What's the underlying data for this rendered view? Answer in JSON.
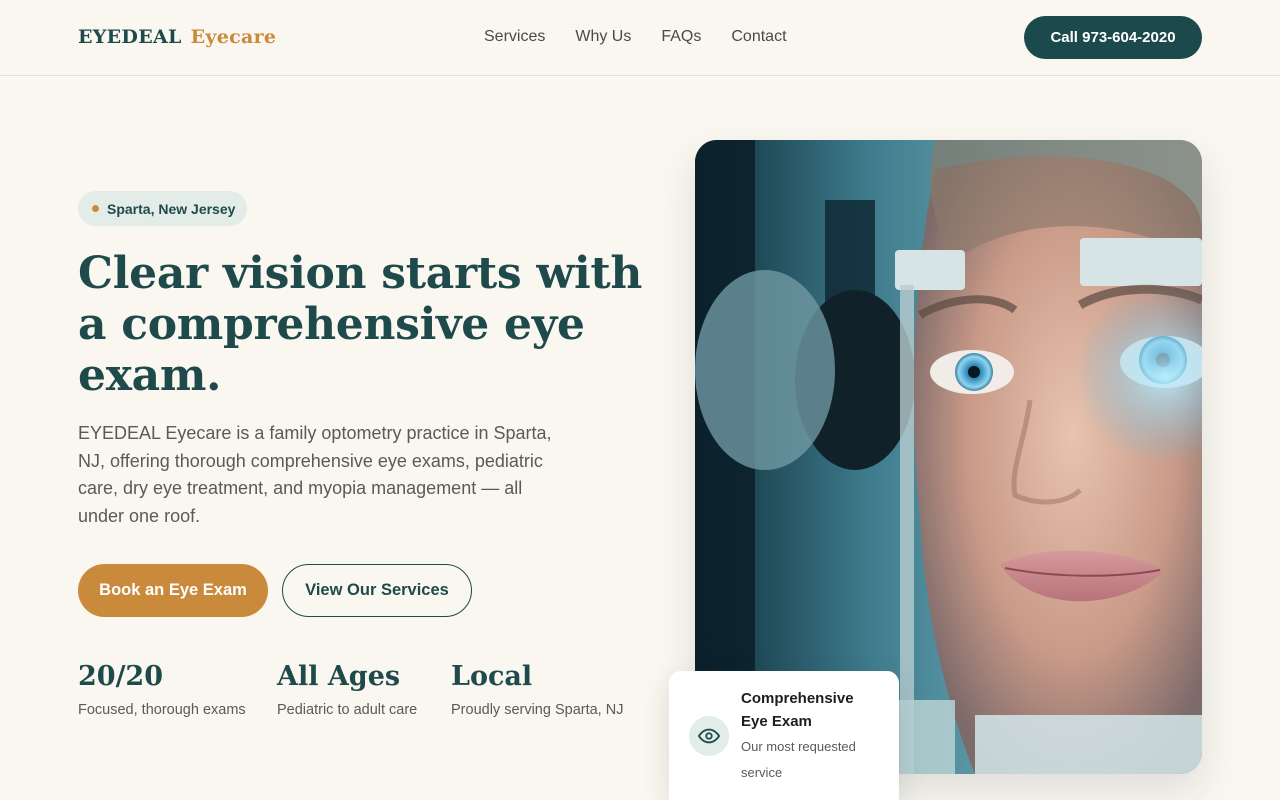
{
  "header": {
    "logo_main": "EYEDEAL",
    "logo_accent": "Eyecare",
    "nav": [
      "Services",
      "Why Us",
      "FAQs",
      "Contact"
    ],
    "call_label": "Call 973-604-2020"
  },
  "hero": {
    "location_badge": "Sparta, New Jersey",
    "headline": "Clear vision starts with a comprehensive eye exam.",
    "description": "EYEDEAL Eyecare is a family optometry practice in Sparta, NJ, offering thorough comprehensive eye exams, pediatric care, dry eye treatment, and myopia management — all under one roof.",
    "primary_cta": "Book an Eye Exam",
    "secondary_cta": "View Our Services",
    "stats": [
      {
        "value": "20/20",
        "label": "Focused, thorough exams"
      },
      {
        "value": "All Ages",
        "label": "Pediatric to adult care"
      },
      {
        "value": "Local",
        "label": "Proudly serving Sparta, NJ"
      }
    ]
  },
  "feature_card": {
    "title": "Comprehensive Eye Exam",
    "subtitle": "Our most requested service",
    "icon": "eye-icon"
  },
  "colors": {
    "background": "#faf6f0",
    "primary_teal": "#1c4a4c",
    "accent_gold": "#c98a3c"
  }
}
